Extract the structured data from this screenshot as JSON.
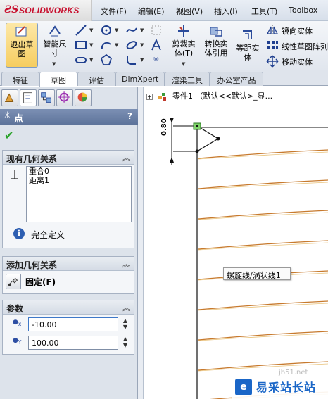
{
  "app": {
    "brand_icon": "ds-logo-icon",
    "brand_name": "SOLIDWORKS"
  },
  "menu": [
    "文件(F)",
    "编辑(E)",
    "视图(V)",
    "插入(I)",
    "工具(T)",
    "Toolbox"
  ],
  "ribbon": {
    "exit_sketch": "退出草图",
    "smart_dimension": "智能尺寸",
    "trim_entities": "剪裁实体(T)",
    "convert_entities": "转换实体引用",
    "offset_entities": "等距实体",
    "mirror_entities": "镜向实体",
    "linear_pattern": "线性草图阵列",
    "move_entities": "移动实体"
  },
  "tabs": [
    "特征",
    "草图",
    "评估",
    "DimXpert",
    "渲染工具",
    "办公室产品"
  ],
  "active_tab_index": 1,
  "property_manager": {
    "title": "点",
    "help": "?",
    "existing_relations": {
      "title": "现有几何关系",
      "items": [
        "重合0",
        "距离1"
      ],
      "status": "完全定义"
    },
    "add_relations": {
      "title": "添加几何关系",
      "fix_label": "固定(F)"
    },
    "parameters": {
      "title": "参数",
      "x_label": "x",
      "y_label": "Y",
      "x_value": "-10.00",
      "y_value": "100.00"
    }
  },
  "graphics": {
    "tree_label": "零件1 （默认<<默认>_显...",
    "dimension_text": "0.80",
    "tooltip": "螺旋线/涡状线1",
    "helix_color": "#c77a2e"
  },
  "watermark": {
    "text": "易采站长站",
    "url": "jb51.net"
  }
}
